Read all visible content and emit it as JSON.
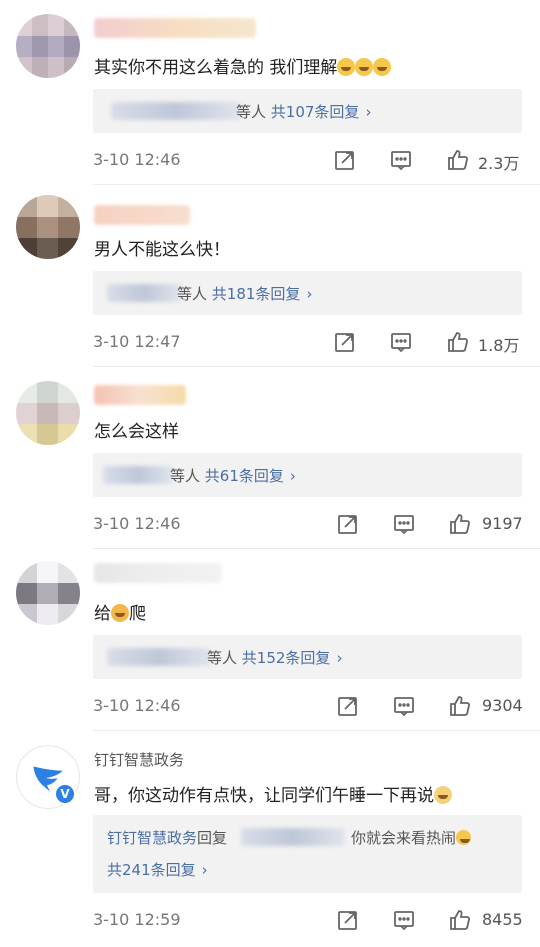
{
  "comments": [
    {
      "text": "其实你不用这么着急的 我们理解",
      "emoji": [
        "laugh-cry",
        "laugh-cry",
        "laugh-cry"
      ],
      "reply_others": "等人",
      "reply_count": "共107条回复",
      "time": "3-10 12:46",
      "likes": "2.3万"
    },
    {
      "text": "男人不能这么快！",
      "reply_others": "等人",
      "reply_count": "共181条回复",
      "time": "3-10 12:47",
      "likes": "1.8万"
    },
    {
      "text": "怎么会这样",
      "reply_others": "等人",
      "reply_count": "共61条回复",
      "time": "3-10 12:46",
      "likes": "9197"
    },
    {
      "text_before": "给",
      "text_after": "爬",
      "reply_others": "等人",
      "reply_count": "共152条回复",
      "time": "3-10 12:46",
      "likes": "9304"
    },
    {
      "author": "钉钉智慧政务",
      "text": "哥，你这动作有点快，让同学们午睡一下再说",
      "reply_author": "钉钉智慧政务",
      "reply_verb": "回复",
      "reply_tail": "你就会来看热闹",
      "reply_count": "共241条回复",
      "time": "3-10 12:59",
      "likes": "8455"
    }
  ],
  "icons": {
    "share": "share-icon",
    "comment": "comment-icon",
    "like": "thumbs-up-icon",
    "chevron": "chevron-right-icon",
    "verified": "verified-v-icon"
  },
  "colors": {
    "link": "#4b6ea5",
    "verified": "#2d7fe3",
    "reply_bg": "#f2f2f2"
  }
}
